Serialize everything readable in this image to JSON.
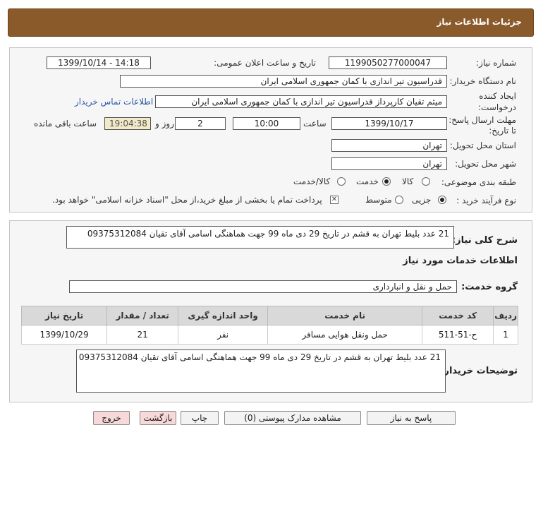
{
  "header": {
    "title": "جزئیات اطلاعات نیاز"
  },
  "form": {
    "need_number_label": "شماره نیاز:",
    "need_number": "1199050277000047",
    "announce_label": "تاریخ و ساعت اعلان عمومی:",
    "announce_value": "1399/10/14 - 14:18",
    "buyer_org_label": "نام دستگاه خریدار:",
    "buyer_org": "قدراسیون تیر اندازی با کمان جمهوری اسلامی ایران",
    "creator_label_1": "ایجاد کننده",
    "creator_label_2": "درخواست:",
    "creator": "میثم تقیان کارپرداز قدراسیون تیر اندازی با کمان جمهوری اسلامی ایران",
    "contact_link": "اطلاعات تماس خریدار",
    "deadline_label_1": "مهلت ارسال پاسخ:",
    "deadline_label_2": "تا تاریخ:",
    "deadline_date": "1399/10/17",
    "time_label": "ساعت",
    "deadline_time": "10:00",
    "days_value": "2",
    "days_label": "روز و",
    "remaining_time": "19:04:38",
    "remaining_label": "ساعت باقی مانده",
    "province_label": "استان محل تحویل:",
    "province": "تهران",
    "city_label": "شهر محل تحویل:",
    "city": "تهران",
    "category_label": "طبقه بندی موضوعی:",
    "category_options": [
      "کالا",
      "خدمت",
      "کالا/خدمت"
    ],
    "category_selected": "خدمت",
    "process_label": "نوع فرآیند خرید :",
    "process_options": [
      "جزیی",
      "متوسط"
    ],
    "process_selected": "جزیی",
    "payment_note": "پرداخت تمام یا بخشی از مبلغ خرید،از محل \"اسناد خزانه اسلامی\" خواهد بود."
  },
  "details": {
    "summary_label": "شرح کلی نیاز:",
    "summary": "21 عدد بلیط تهران به قشم در تاریخ 29 دی ماه 99 جهت هماهنگی اسامی آقای تقیان 09375312084",
    "services_heading": "اطلاعات خدمات مورد نیاز",
    "service_group_label": "گروه خدمت:",
    "service_group": "حمل و نقل و انبارداری",
    "table": {
      "headers": [
        "ردیف",
        "کد خدمت",
        "نام خدمت",
        "واحد اندازه گیری",
        "تعداد / مقدار",
        "تاریخ نیاز"
      ],
      "rows": [
        [
          "1",
          "ح-51-511",
          "حمل ونقل هوایی مسافر",
          "نفر",
          "21",
          "1399/10/29"
        ]
      ]
    },
    "buyer_notes_label": "توضیحات خریدار:",
    "buyer_notes": "21 عدد بلیط تهران به قشم در تاریخ 29 دی ماه 99 جهت هماهنگی اسامی آقای تقیان 09375312084"
  },
  "buttons": {
    "reply": "پاسخ به نیاز",
    "attachments": "مشاهده مدارک پیوستی (0)",
    "print": "چاپ",
    "back": "بازگشت",
    "exit": "خروج"
  },
  "colors": {
    "header_bg": "#8b5a2b",
    "link": "#2a55a8",
    "remaining_bg": "#f1e9c8"
  }
}
